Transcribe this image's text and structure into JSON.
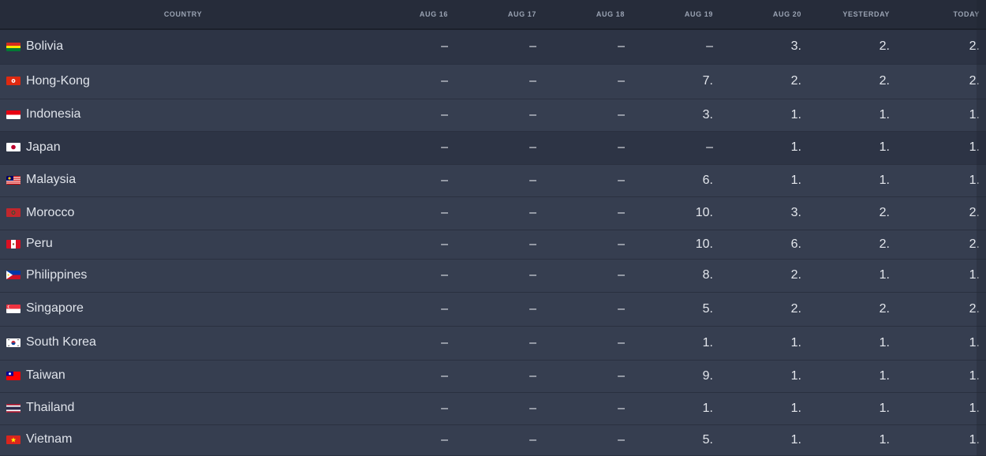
{
  "table": {
    "headers": {
      "country": "COUNTRY",
      "aug16": "AUG 16",
      "aug17": "AUG 17",
      "aug18": "AUG 18",
      "aug19": "AUG 19",
      "aug20": "AUG 20",
      "yesterday": "YESTERDAY",
      "today": "TODAY"
    },
    "rows": [
      {
        "country": "Bolivia",
        "flag": "bolivia-flag-icon",
        "aug16": "–",
        "aug17": "–",
        "aug18": "–",
        "aug19": "–",
        "aug20": "3.",
        "yesterday": "2.",
        "today": "2."
      },
      {
        "country": "Hong-Kong",
        "flag": "hong-kong-flag-icon",
        "aug16": "–",
        "aug17": "–",
        "aug18": "–",
        "aug19": "7.",
        "aug20": "2.",
        "yesterday": "2.",
        "today": "2."
      },
      {
        "country": "Indonesia",
        "flag": "indonesia-flag-icon",
        "aug16": "–",
        "aug17": "–",
        "aug18": "–",
        "aug19": "3.",
        "aug20": "1.",
        "yesterday": "1.",
        "today": "1."
      },
      {
        "country": "Japan",
        "flag": "japan-flag-icon",
        "aug16": "–",
        "aug17": "–",
        "aug18": "–",
        "aug19": "–",
        "aug20": "1.",
        "yesterday": "1.",
        "today": "1."
      },
      {
        "country": "Malaysia",
        "flag": "malaysia-flag-icon",
        "aug16": "–",
        "aug17": "–",
        "aug18": "–",
        "aug19": "6.",
        "aug20": "1.",
        "yesterday": "1.",
        "today": "1."
      },
      {
        "country": "Morocco",
        "flag": "morocco-flag-icon",
        "aug16": "–",
        "aug17": "–",
        "aug18": "–",
        "aug19": "10.",
        "aug20": "3.",
        "yesterday": "2.",
        "today": "2."
      },
      {
        "country": "Peru",
        "flag": "peru-flag-icon",
        "aug16": "–",
        "aug17": "–",
        "aug18": "–",
        "aug19": "10.",
        "aug20": "6.",
        "yesterday": "2.",
        "today": "2."
      },
      {
        "country": "Philippines",
        "flag": "philippines-flag-icon",
        "aug16": "–",
        "aug17": "–",
        "aug18": "–",
        "aug19": "8.",
        "aug20": "2.",
        "yesterday": "1.",
        "today": "1."
      },
      {
        "country": "Singapore",
        "flag": "singapore-flag-icon",
        "aug16": "–",
        "aug17": "–",
        "aug18": "–",
        "aug19": "5.",
        "aug20": "2.",
        "yesterday": "2.",
        "today": "2."
      },
      {
        "country": "South Korea",
        "flag": "south-korea-flag-icon",
        "aug16": "–",
        "aug17": "–",
        "aug18": "–",
        "aug19": "1.",
        "aug20": "1.",
        "yesterday": "1.",
        "today": "1."
      },
      {
        "country": "Taiwan",
        "flag": "taiwan-flag-icon",
        "aug16": "–",
        "aug17": "–",
        "aug18": "–",
        "aug19": "9.",
        "aug20": "1.",
        "yesterday": "1.",
        "today": "1."
      },
      {
        "country": "Thailand",
        "flag": "thailand-flag-icon",
        "aug16": "–",
        "aug17": "–",
        "aug18": "–",
        "aug19": "1.",
        "aug20": "1.",
        "yesterday": "1.",
        "today": "1."
      },
      {
        "country": "Vietnam",
        "flag": "vietnam-flag-icon",
        "aug16": "–",
        "aug17": "–",
        "aug18": "–",
        "aug19": "5.",
        "aug20": "1.",
        "yesterday": "1.",
        "today": "1."
      }
    ]
  }
}
